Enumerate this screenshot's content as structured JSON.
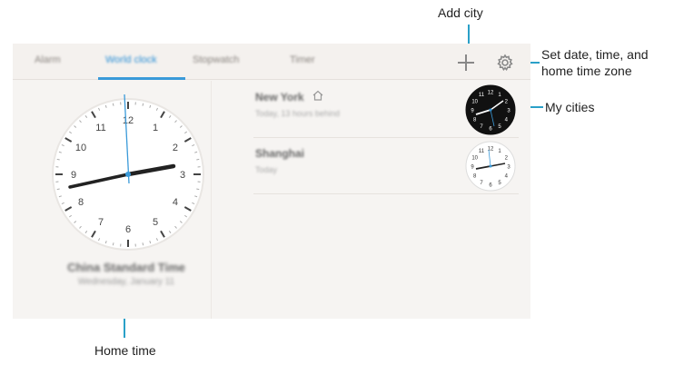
{
  "annotations": {
    "add_city": "Add city",
    "settings": "Set date, time, and\nhome time zone",
    "settings_line1": "Set date, time, and",
    "settings_line2": "home time zone",
    "my_cities": "My cities",
    "home_time": "Home time"
  },
  "tabs": [
    {
      "label": "Alarm",
      "active": false
    },
    {
      "label": "World clock",
      "active": true
    },
    {
      "label": "Stopwatch",
      "active": false
    },
    {
      "label": "Timer",
      "active": false
    }
  ],
  "toolbar": {
    "add_icon": "plus-icon",
    "settings_icon": "gear-icon"
  },
  "home_clock": {
    "numbers": [
      "12",
      "1",
      "2",
      "3",
      "4",
      "5",
      "6",
      "7",
      "8",
      "9",
      "10",
      "11"
    ],
    "zone": "China Standard Time",
    "date": "Wednesday, January 11"
  },
  "cities": [
    {
      "name": "New York",
      "sub": "Today, 13 hours behind",
      "is_home": true,
      "style": "dark"
    },
    {
      "name": "Shanghai",
      "sub": "Today",
      "is_home": false,
      "style": "light"
    }
  ],
  "colors": {
    "accent": "#3a9ad9",
    "callout": "#2aa0c8",
    "screen_bg": "#f6f4f2"
  }
}
